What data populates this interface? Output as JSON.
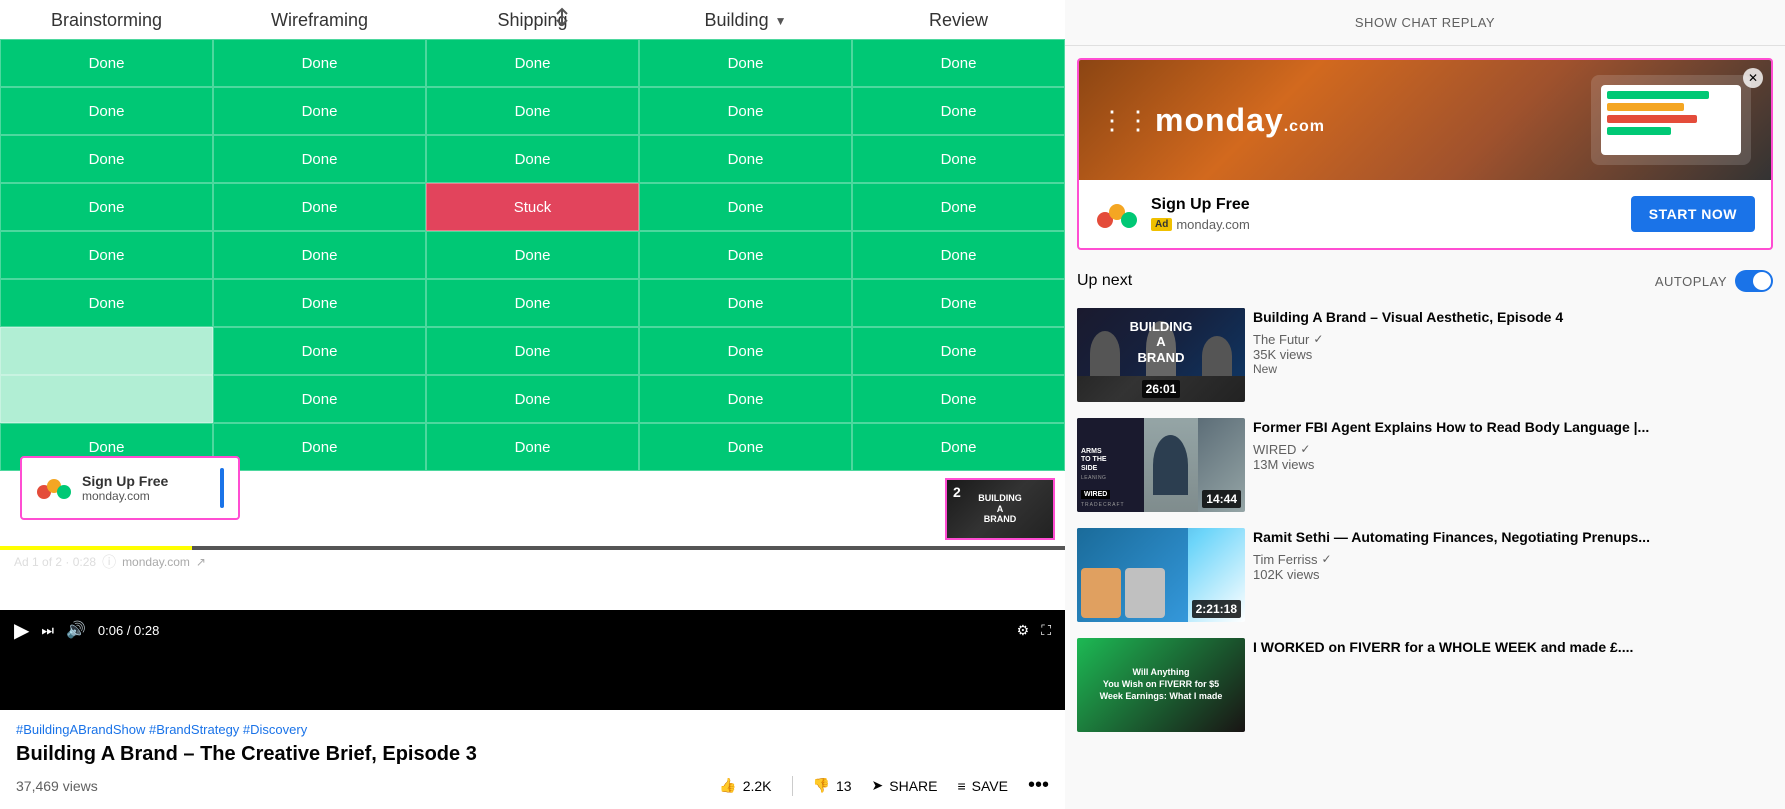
{
  "chatReplay": {
    "label": "SHOW CHAT REPLAY"
  },
  "ad": {
    "panel": {
      "signupText": "Sign Up Free",
      "adLabel": "Ad",
      "domain": "monday.com",
      "startNowLabel": "START NOW",
      "closeIcon": "✕"
    },
    "overlay": {
      "signupText": "Sign Up Free",
      "domain": "monday.com"
    },
    "infoBar": "Ad 1 of 2 · 0:28",
    "infoDomain": "monday.com"
  },
  "grid": {
    "headers": [
      "Brainstorming",
      "Wireframing",
      "Shipping",
      "Building",
      "Review"
    ],
    "rows": [
      [
        "Done",
        "Done",
        "Done",
        "Done",
        "Done"
      ],
      [
        "Done",
        "Done",
        "Done",
        "Done",
        "Done"
      ],
      [
        "Done",
        "Done",
        "Done",
        "Done",
        "Done"
      ],
      [
        "Done",
        "Done",
        "Stuck",
        "Done",
        "Done"
      ],
      [
        "Done",
        "Done",
        "Done",
        "Done",
        "Done"
      ],
      [
        "Done",
        "Done",
        "Done",
        "Done",
        "Done"
      ],
      [
        "",
        "Done",
        "Done",
        "Done",
        "Done"
      ],
      [
        "",
        "Done",
        "Done",
        "Done",
        "Done"
      ],
      [
        "Done",
        "Done",
        "Done",
        "Done",
        "Done"
      ]
    ]
  },
  "video": {
    "hashtags": "#BuildingABrandShow #BrandStrategy #Discovery",
    "title": "Building A Brand – The Creative Brief, Episode 3",
    "views": "37,469 views",
    "likes": "2.2K",
    "dislikes": "13",
    "shareLabel": "SHARE",
    "saveLabel": "SAVE"
  },
  "upNext": {
    "label": "Up next",
    "autoplay": "AUTOPLAY"
  },
  "videoList": [
    {
      "title": "Building A Brand – Visual Aesthetic, Episode 4",
      "channel": "The Futur",
      "verified": true,
      "views": "35K views",
      "badge": "New",
      "duration": "26:01",
      "thumbType": "building"
    },
    {
      "title": "Former FBI Agent Explains How to Read Body Language |...",
      "channel": "WIRED",
      "verified": true,
      "views": "13M views",
      "badge": "",
      "duration": "14:44",
      "thumbType": "fbi"
    },
    {
      "title": "Ramit Sethi — Automating Finances, Negotiating Prenups...",
      "channel": "Tim Ferriss",
      "verified": true,
      "views": "102K views",
      "badge": "",
      "duration": "2:21:18",
      "thumbType": "ramit"
    },
    {
      "title": "I WORKED on FIVERR for a WHOLE WEEK and made £....",
      "channel": "",
      "verified": false,
      "views": "",
      "badge": "",
      "duration": "",
      "thumbType": "fiverr"
    }
  ]
}
